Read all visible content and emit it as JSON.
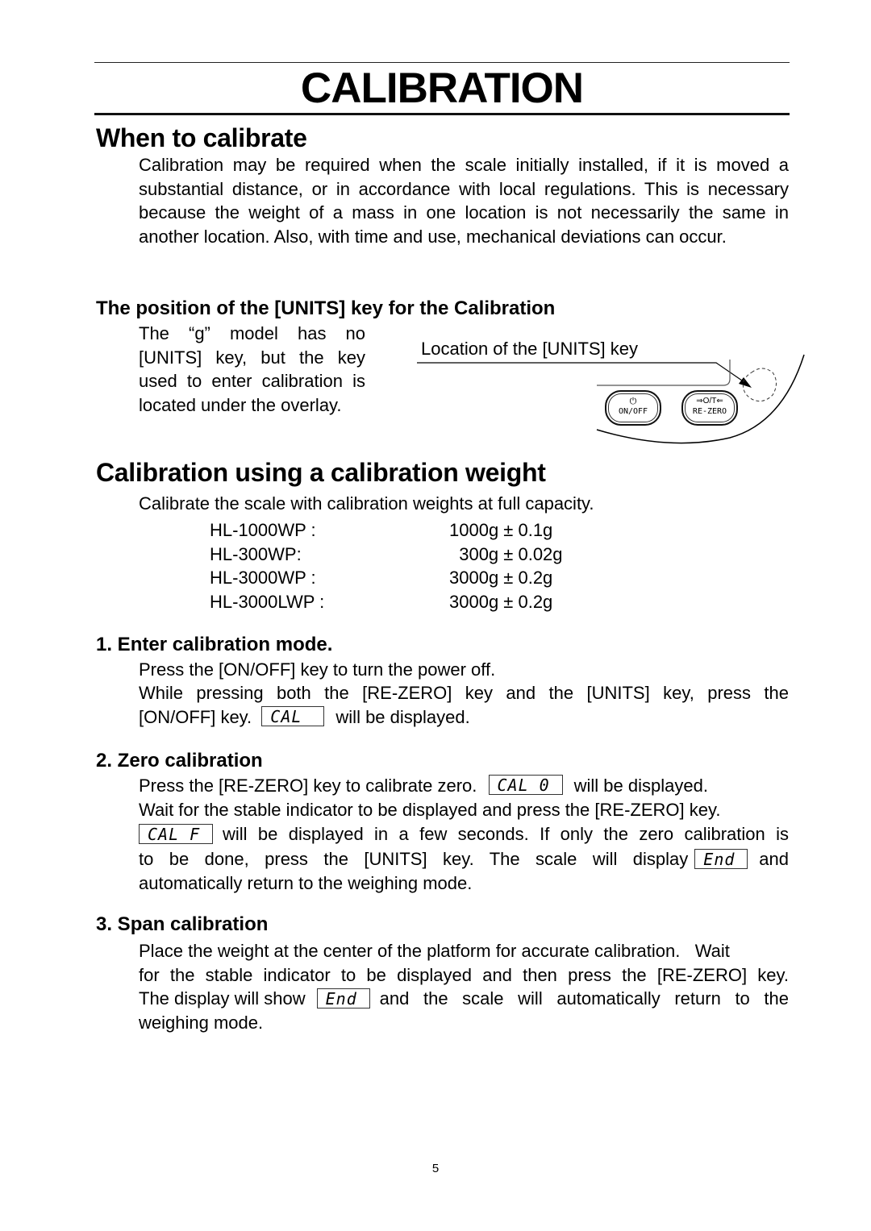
{
  "page": {
    "title": "CALIBRATION",
    "page_number": "5"
  },
  "when": {
    "heading": "When to calibrate",
    "body": "Calibration may be required when the scale initially installed, if it is moved a substantial distance, or in accordance with local regulations. This is necessary because the weight of a mass in one location is not necessarily the same in another location. Also, with time and use, mechanical deviations can occur."
  },
  "units_key": {
    "heading": "The position of the [UNITS] key for the Calibration",
    "note": "The “g” model has no [UNITS] key, but the key used to enter calibration is located under the overlay.",
    "figure_label": "Location of the [UNITS] key",
    "on_off_symbol": "⏻",
    "on_off_label": "ON/OFF",
    "re_zero_symbol": "⇒O/T⇐",
    "re_zero_label": "RE-ZERO"
  },
  "weight": {
    "heading": "Calibration using a calibration weight",
    "intro": "Calibrate the scale with calibration weights at full capacity.",
    "specs": [
      {
        "model": "HL-1000WP :",
        "value": "1000g ± 0.1g"
      },
      {
        "model": "HL-300WP:",
        "value": "  300g ± 0.02g"
      },
      {
        "model": "HL-3000WP :",
        "value": "3000g ± 0.2g"
      },
      {
        "model": "HL-3000LWP :",
        "value": "3000g ± 0.2g"
      }
    ]
  },
  "step1": {
    "heading": "1. Enter calibration mode.",
    "line1": "Press the [ON/OFF] key to turn the power off.",
    "line2": "While pressing both the [RE-ZERO] key and the [UNITS] key, press the",
    "line3a": "[ON/OFF] key.",
    "display": "CAL",
    "line3b": "will be displayed."
  },
  "step2": {
    "heading": "2. Zero calibration",
    "line1a": "Press the [RE-ZERO] key to calibrate zero.",
    "display1": "CAL 0",
    "line1b": "will be displayed.",
    "line2": "Wait for the stable indicator to be displayed and press the [RE-ZERO] key.",
    "display2": "CAL F",
    "line3": "will be displayed in a few seconds. If only the zero calibration is",
    "line4a": "to be done, press the [UNITS] key. The scale will display",
    "display3": "End",
    "line4b": "and",
    "line5": "automatically return to the weighing mode."
  },
  "step3": {
    "heading": "3. Span calibration",
    "line1": "Place the weight at the center of the platform for accurate calibration.   Wait",
    "line2": "for the stable indicator to be displayed and then press the [RE-ZERO] key.",
    "line3a": "The display will show",
    "display": "End",
    "line3b": "and the scale will automatically return to the",
    "line4": "weighing mode."
  }
}
